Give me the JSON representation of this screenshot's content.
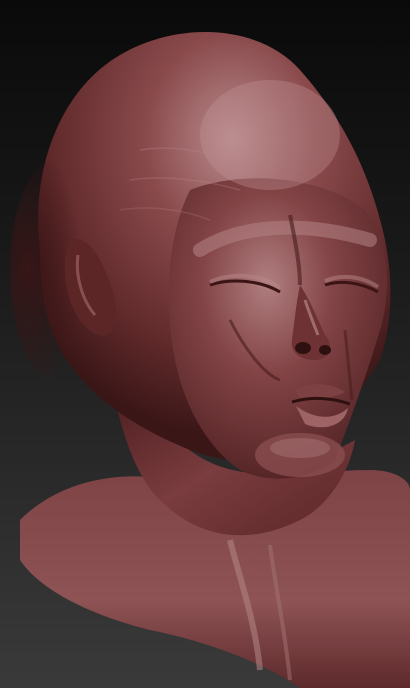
{
  "scene": {
    "subject": "sculpted-bust",
    "material": "red-wax",
    "colors": {
      "background_top": "#0a0a0a",
      "background_bottom": "#3a3a3a",
      "material_base": "#7a3c3e",
      "material_highlight": "#c59a9b",
      "material_shadow": "#2e1213"
    }
  }
}
